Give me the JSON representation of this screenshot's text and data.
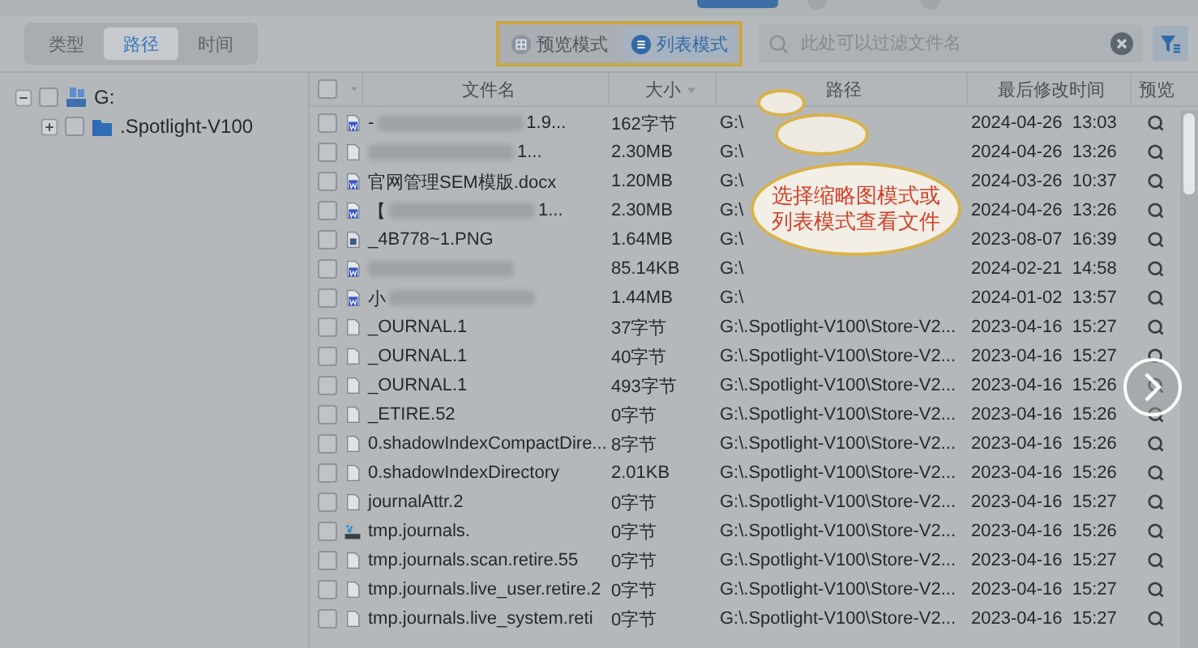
{
  "view_tabs": [
    {
      "label": "类型",
      "selected": false
    },
    {
      "label": "路径",
      "selected": true
    },
    {
      "label": "时间",
      "selected": false
    }
  ],
  "mode_toggle": [
    {
      "label": "预览模式",
      "kind": "grid",
      "selected": false
    },
    {
      "label": "列表模式",
      "kind": "list",
      "selected": true
    }
  ],
  "search": {
    "placeholder": "此处可以过滤文件名"
  },
  "tree": [
    {
      "label": "G:",
      "kind": "drive",
      "expanded": true,
      "checked": false,
      "children": [
        {
          "label": ".Spotlight-V100",
          "kind": "folder",
          "expanded": false,
          "checked": false
        }
      ]
    }
  ],
  "table": {
    "columns": [
      "文件名",
      "大小",
      "路径",
      "最后修改时间",
      "预览"
    ],
    "rows": [
      {
        "kind": "word",
        "checked": false,
        "name_parts": [
          {
            "kind": "text",
            "text": "-"
          },
          {
            "kind": "blurred"
          },
          {
            "kind": "text",
            "text": "1.9..."
          }
        ],
        "size": "162字节",
        "path": "G:\\",
        "modified": "2024-04-26  13:03"
      },
      {
        "kind": "file",
        "checked": false,
        "name_parts": [
          {
            "kind": "blurred"
          },
          {
            "kind": "text",
            "text": "1..."
          }
        ],
        "size": "2.30MB",
        "path": "G:\\",
        "modified": "2024-04-26  13:26"
      },
      {
        "kind": "word",
        "checked": false,
        "name_parts": [
          {
            "kind": "text",
            "text": "官网管理SEM模版.docx"
          }
        ],
        "size": "1.20MB",
        "path": "G:\\",
        "modified": "2024-03-26  10:37"
      },
      {
        "kind": "word",
        "checked": false,
        "name_parts": [
          {
            "kind": "text",
            "text": "【"
          },
          {
            "kind": "blurred"
          },
          {
            "kind": "text",
            "text": "1..."
          }
        ],
        "size": "2.30MB",
        "path": "G:\\",
        "modified": "2024-04-26  13:26"
      },
      {
        "kind": "image",
        "checked": false,
        "name_parts": [
          {
            "kind": "text",
            "text": "_4B778~1.PNG"
          }
        ],
        "size": "1.64MB",
        "path": "G:\\",
        "modified": "2023-08-07  16:39"
      },
      {
        "kind": "word",
        "checked": false,
        "name_parts": [
          {
            "kind": "blurred"
          }
        ],
        "size": "85.14KB",
        "path": "G:\\",
        "modified": "2024-02-21  14:58"
      },
      {
        "kind": "word",
        "checked": false,
        "name_parts": [
          {
            "kind": "text",
            "text": "小"
          },
          {
            "kind": "blurred"
          }
        ],
        "size": "1.44MB",
        "path": "G:\\",
        "modified": "2024-01-02  13:57"
      },
      {
        "kind": "file",
        "checked": false,
        "name_parts": [
          {
            "kind": "text",
            "text": "_OURNAL.1"
          }
        ],
        "size": "37字节",
        "path": "G:\\.Spotlight-V100\\Store-V2...",
        "modified": "2023-04-16  15:27"
      },
      {
        "kind": "file",
        "checked": false,
        "name_parts": [
          {
            "kind": "text",
            "text": "_OURNAL.1"
          }
        ],
        "size": "40字节",
        "path": "G:\\.Spotlight-V100\\Store-V2...",
        "modified": "2023-04-16  15:27"
      },
      {
        "kind": "file",
        "checked": false,
        "name_parts": [
          {
            "kind": "text",
            "text": "_OURNAL.1"
          }
        ],
        "size": "493字节",
        "path": "G:\\.Spotlight-V100\\Store-V2...",
        "modified": "2023-04-16  15:26"
      },
      {
        "kind": "file",
        "checked": false,
        "name_parts": [
          {
            "kind": "text",
            "text": "_ETIRE.52"
          }
        ],
        "size": "0字节",
        "path": "G:\\.Spotlight-V100\\Store-V2...",
        "modified": "2023-04-16  15:26"
      },
      {
        "kind": "file",
        "checked": false,
        "name_parts": [
          {
            "kind": "text",
            "text": "0.shadowIndexCompactDire..."
          }
        ],
        "size": "8字节",
        "path": "G:\\.Spotlight-V100\\Store-V2...",
        "modified": "2023-04-16  15:26"
      },
      {
        "kind": "file",
        "checked": false,
        "name_parts": [
          {
            "kind": "text",
            "text": "0.shadowIndexDirectory"
          }
        ],
        "size": "2.01KB",
        "path": "G:\\.Spotlight-V100\\Store-V2...",
        "modified": "2023-04-16  15:26"
      },
      {
        "kind": "file",
        "checked": false,
        "name_parts": [
          {
            "kind": "text",
            "text": "journalAttr.2"
          }
        ],
        "size": "0字节",
        "path": "G:\\.Spotlight-V100\\Store-V2...",
        "modified": "2023-04-16  15:27"
      },
      {
        "kind": "system",
        "checked": false,
        "name_parts": [
          {
            "kind": "text",
            "text": "tmp.journals."
          }
        ],
        "size": "0字节",
        "path": "G:\\.Spotlight-V100\\Store-V2...",
        "modified": "2023-04-16  15:26"
      },
      {
        "kind": "file",
        "checked": false,
        "name_parts": [
          {
            "kind": "text",
            "text": "tmp.journals.scan.retire.55"
          }
        ],
        "size": "0字节",
        "path": "G:\\.Spotlight-V100\\Store-V2...",
        "modified": "2023-04-16  15:27"
      },
      {
        "kind": "file",
        "checked": false,
        "name_parts": [
          {
            "kind": "text",
            "text": "tmp.journals.live_user.retire.2"
          }
        ],
        "size": "0字节",
        "path": "G:\\.Spotlight-V100\\Store-V2...",
        "modified": "2023-04-16  15:27"
      },
      {
        "kind": "file",
        "checked": false,
        "name_parts": [
          {
            "kind": "text",
            "text": "tmp.journals.live_system.reti"
          }
        ],
        "size": "0字节",
        "path": "G:\\.Spotlight-V100\\Store-V2...",
        "modified": "2023-04-16  15:27"
      }
    ],
    "select_all_checked": false
  },
  "callout": {
    "lines": [
      "选择缩略图模式或",
      "列表模式查看文件"
    ]
  }
}
